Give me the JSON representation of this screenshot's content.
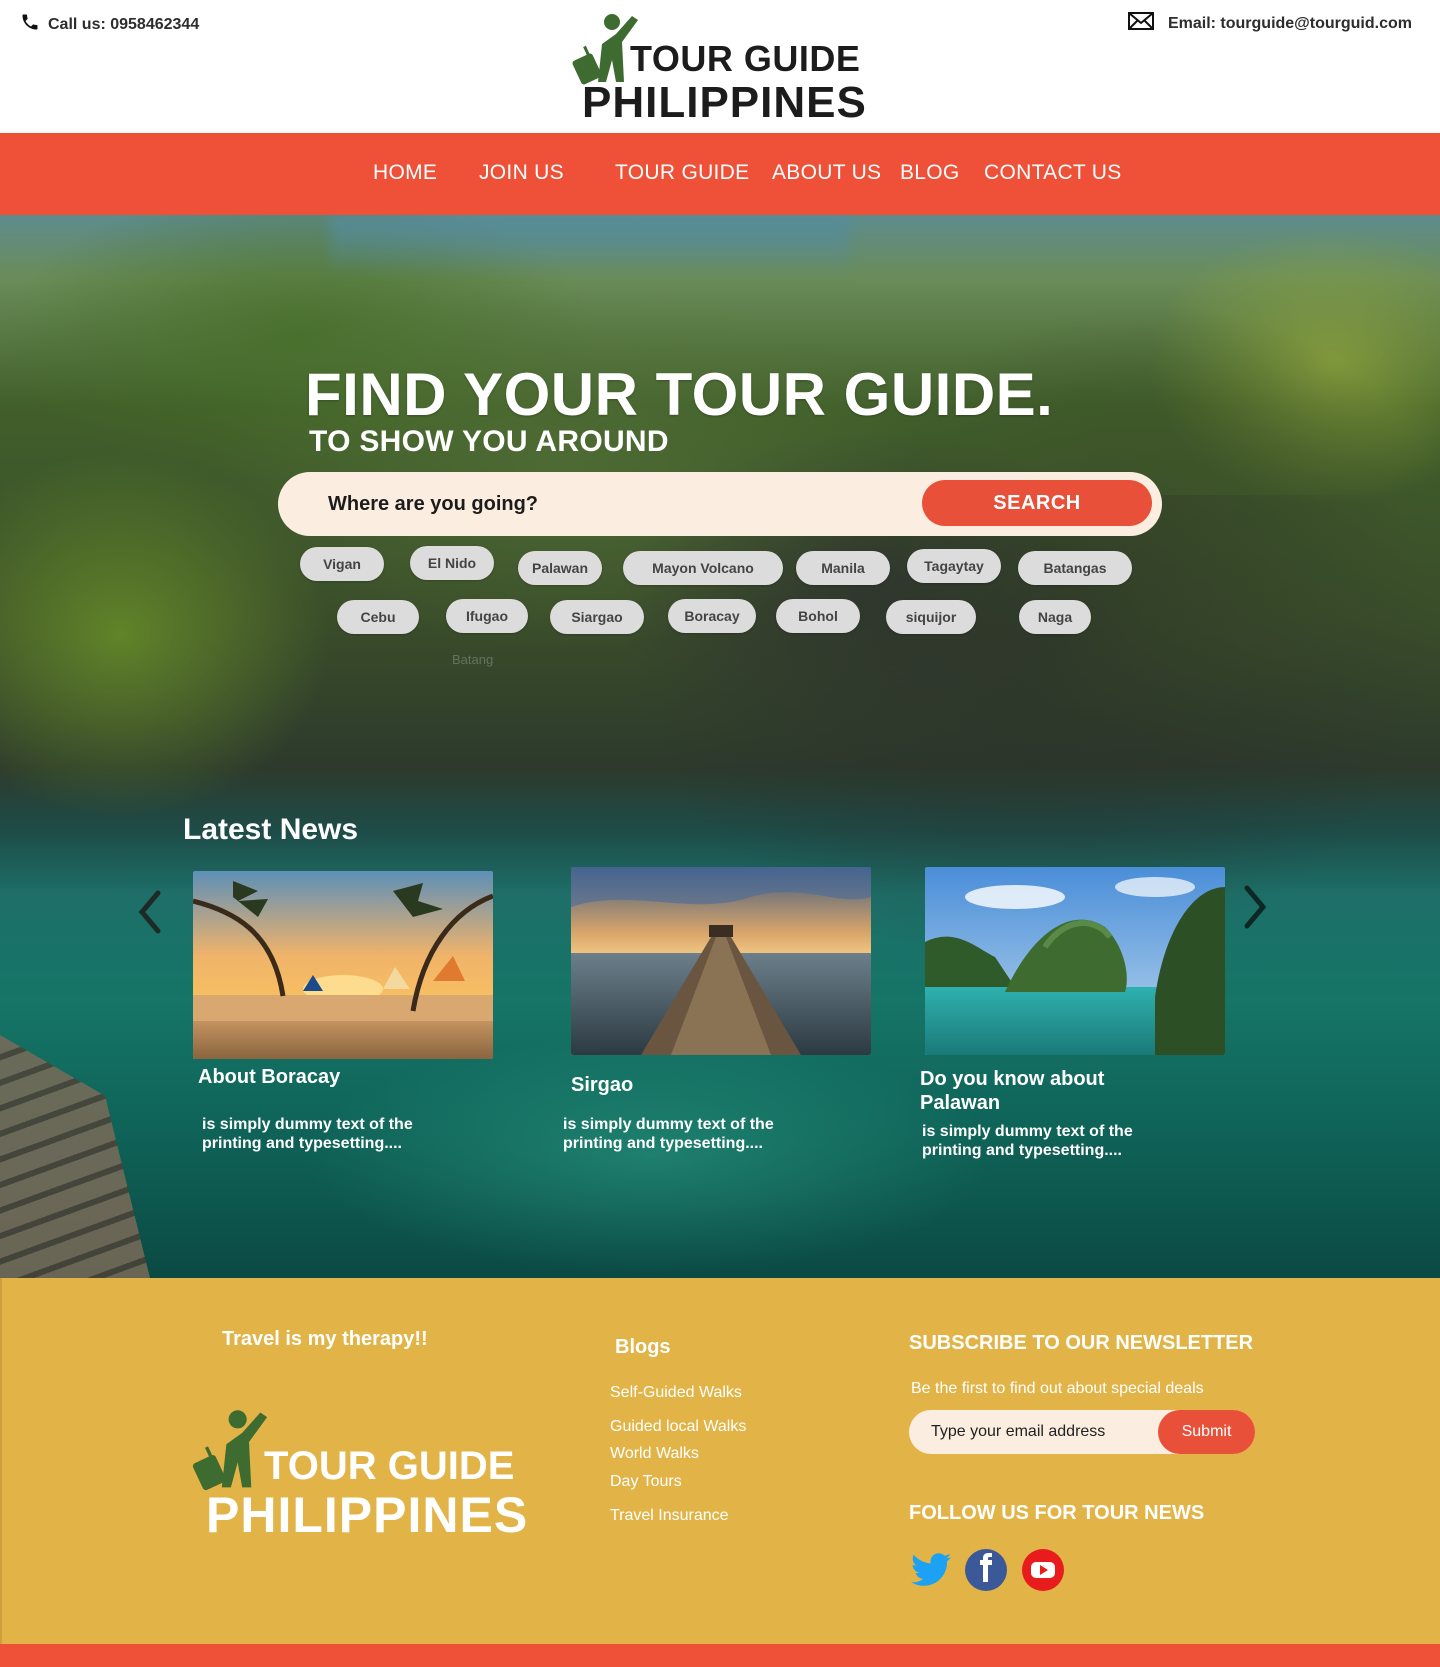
{
  "topbar": {
    "phone_label": "Call us: 0958462344",
    "email_label": "Email: tourguide@tourguid.com",
    "logo_line1": "TOUR GUIDE",
    "logo_line2": "PHILIPPINES"
  },
  "nav": {
    "items": [
      {
        "label": "HOME"
      },
      {
        "label": "JOIN US"
      },
      {
        "label": "TOUR GUIDE"
      },
      {
        "label": "ABOUT US"
      },
      {
        "label": "BLOG"
      },
      {
        "label": "CONTACT US"
      }
    ]
  },
  "hero": {
    "title": "FIND YOUR TOUR GUIDE.",
    "subtitle": "TO SHOW YOU AROUND",
    "search_placeholder": "Where are you going?",
    "search_button": "SEARCH",
    "tags_row1": [
      "Vigan",
      "El Nido",
      "Palawan",
      "Mayon Volcano",
      "Manila",
      "Tagaytay",
      "Batangas"
    ],
    "tags_row2": [
      "Cebu",
      "Ifugao",
      "Siargao",
      "Boracay",
      "Bohol",
      "siquijor",
      "Naga"
    ],
    "ghost_tag": "Batang"
  },
  "news": {
    "section_title": "Latest News",
    "cards": [
      {
        "title": "About Boracay",
        "text": "is simply dummy text of the printing and typesetting...."
      },
      {
        "title": "Sirgao",
        "text": "is simply dummy text of the printing and typesetting...."
      },
      {
        "title": "Do you know about Palawan",
        "text": "is simply dummy text of the printing and typesetting...."
      }
    ]
  },
  "footer": {
    "tagline": "Travel is my therapy!!",
    "logo_line1": "TOUR GUIDE",
    "logo_line2": "PHILIPPINES",
    "blogs_title": "Blogs",
    "blog_links": [
      "Self-Guided Walks",
      "Guided local Walks",
      "World Walks",
      "Day Tours",
      "Travel Insurance"
    ],
    "newsletter_title": "SUBSCRIBE TO OUR NEWSLETTER",
    "newsletter_text": "Be the first to find out about special deals",
    "email_placeholder": "Type your email address",
    "submit_label": "Submit",
    "follow_title": "FOLLOW US FOR TOUR NEWS",
    "socials": [
      "twitter-icon",
      "facebook-icon",
      "youtube-icon"
    ]
  },
  "colors": {
    "accent": "#ee5138",
    "footer_bg": "#e2b448",
    "logo_green": "#3e6b30",
    "search_bg": "#fbeee0"
  }
}
